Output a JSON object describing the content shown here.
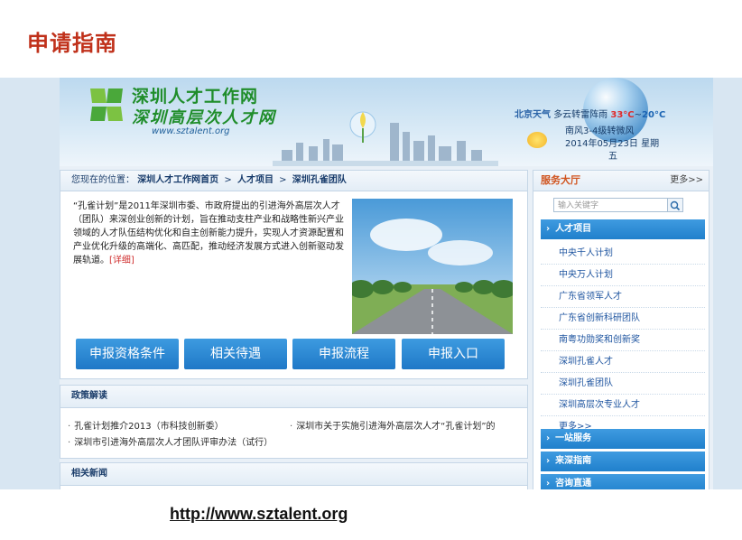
{
  "slide": {
    "title": "申请指南",
    "url": "http://www.sztalent.org"
  },
  "header": {
    "logo_cn": "深圳人才工作网",
    "logo_cn2": "深圳高层次人才网",
    "logo_url": "www.sztalent.org",
    "weather_city": "北京天气",
    "weather_desc": "多云转雷阵雨",
    "temp_high": "33°C",
    "temp_sep": "~",
    "temp_low": "20°C",
    "wind": "南风3-4级转微风",
    "date": "2014年05月23日 星期",
    "weekday": "五"
  },
  "breadcrumb": {
    "prefix": "您现在的位置：",
    "items": [
      "深圳人才工作网首页",
      "人才项目",
      "深圳孔雀团队"
    ],
    "sep": ">"
  },
  "intro": {
    "text": "“孔雀计划”是2011年深圳市委、市政府提出的引进海外高层次人才（团队）来深创业创新的计划，旨在推动支柱产业和战略性新兴产业领域的人才队伍结构优化和自主创新能力提升，实现人才资源配置和产业优化升级的高端化、高匹配，推动经济发展方式进入创新驱动发展轨道。",
    "more": "[详细]"
  },
  "buttons": [
    "申报资格条件",
    "相关待遇",
    "申报流程",
    "申报入口"
  ],
  "policy": {
    "title": "政策解读",
    "items": [
      "孔雀计划推介2013（市科技创新委）",
      "深圳市关于实施引进海外高层次人才“孔雀计划”的",
      "深圳市引进海外高层次人才团队评审办法（试行）"
    ]
  },
  "news": {
    "title": "相关新闻"
  },
  "sidebar": {
    "title": "服务大厅",
    "more": "更多>>",
    "search_placeholder": "输入关键字",
    "categories": [
      "人才项目",
      "一站服务",
      "来深指南",
      "咨询直通"
    ],
    "cat_arrow": "›",
    "items": [
      "中央千人计划",
      "中央万人计划",
      "广东省领军人才",
      "广东省创新科研团队",
      "南粤功勋奖和创新奖",
      "深圳孔雀人才",
      "深圳孔雀团队",
      "深圳高层次专业人才",
      "更多>>"
    ]
  },
  "colors": {
    "title_red": "#c0311b",
    "accent_blue": "#2080cc",
    "sidebar_title": "#d0541f"
  }
}
